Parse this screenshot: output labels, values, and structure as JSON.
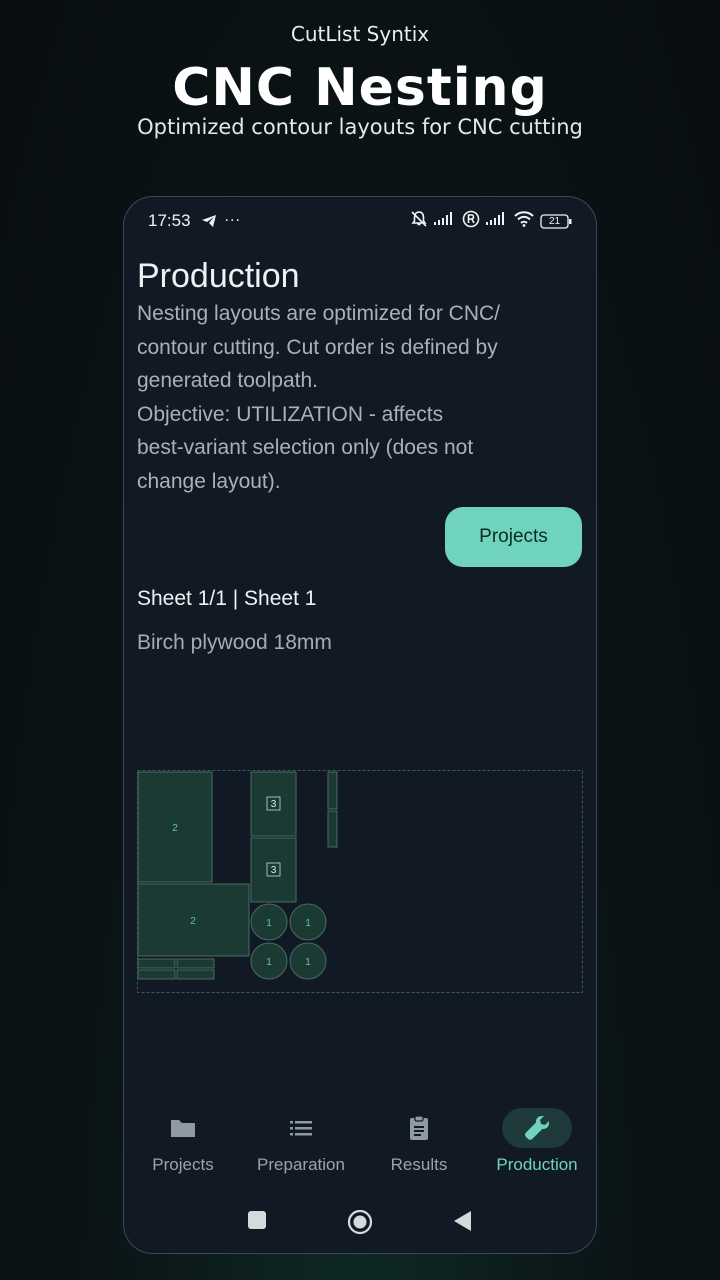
{
  "promo": {
    "brand": "CutList Syntix",
    "title": "CNC Nesting",
    "subtitle": "Optimized contour layouts for CNC cutting"
  },
  "status_bar": {
    "time": "17:53",
    "dots": "···",
    "battery": "21"
  },
  "page": {
    "title": "Production",
    "description_lines": [
      "Nesting layouts are optimized for CNC/",
      "contour cutting. Cut order is defined by",
      "generated toolpath.",
      "Objective: UTILIZATION - affects",
      "best-variant selection only (does not",
      "change layout)."
    ],
    "projects_button": "Projects",
    "sheet_title": "Sheet 1/1 | Sheet 1",
    "material": "Birch plywood 18mm"
  },
  "layout": {
    "part_labels": [
      "2",
      "2",
      "3",
      "3",
      "1",
      "1",
      "1",
      "1"
    ],
    "colors": {
      "part_fill": "#1b3a33",
      "part_stroke": "#4a6b63",
      "label": "#5fc2ad",
      "sheet_border": "#3d5a58"
    }
  },
  "nav": {
    "items": [
      {
        "label": "Projects",
        "icon": "folder-icon"
      },
      {
        "label": "Preparation",
        "icon": "list-icon"
      },
      {
        "label": "Results",
        "icon": "clipboard-icon"
      },
      {
        "label": "Production",
        "icon": "wrench-icon"
      }
    ],
    "active_index": 3
  },
  "colors": {
    "accent": "#6fd3be",
    "screen_bg": "#111a24",
    "muted_text": "#a8b1b8"
  }
}
